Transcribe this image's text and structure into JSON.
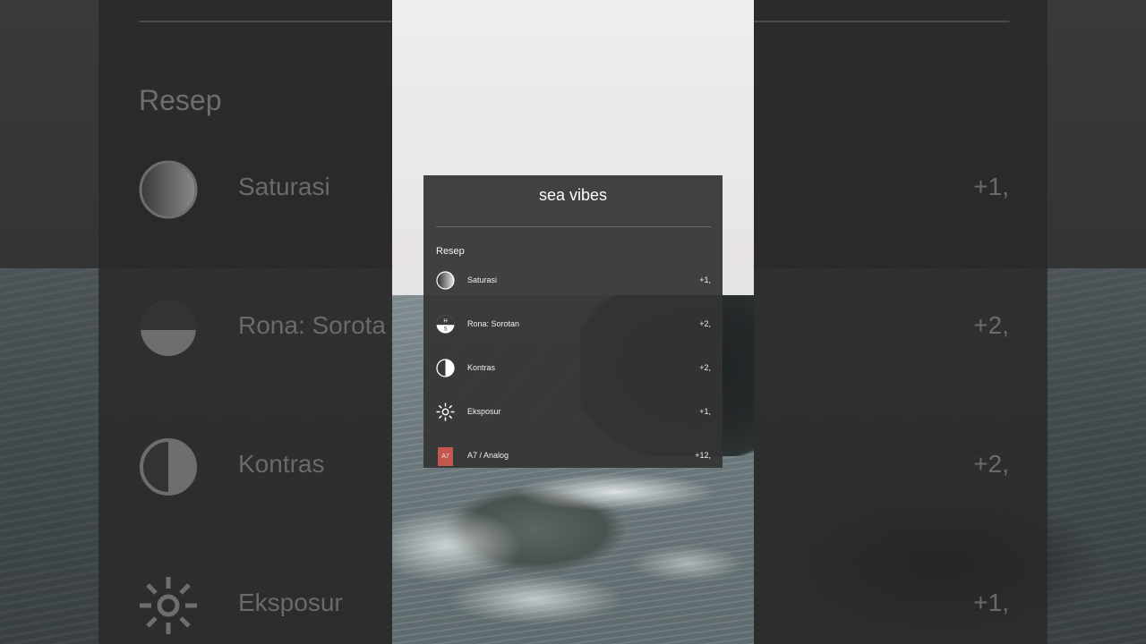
{
  "recipe": {
    "title": "sea vibes",
    "heading": "Resep",
    "items": [
      {
        "label": "Saturasi",
        "value": "+1,",
        "icon": "saturation-icon"
      },
      {
        "label": "Rona: Sorotan",
        "value": "+2,",
        "icon": "hue-shadow-icon"
      },
      {
        "label": "Kontras",
        "value": "+2,",
        "icon": "contrast-icon"
      },
      {
        "label": "Eksposur",
        "value": "+1,",
        "icon": "exposure-icon"
      },
      {
        "label": "A7 / Analog",
        "value": "+12,",
        "icon": "filter-badge-icon",
        "badge": "A7",
        "badge_color": "#c4574f"
      }
    ]
  },
  "background": {
    "heading": "Resep",
    "items": [
      {
        "label": "Saturasi",
        "value": "+1,"
      },
      {
        "label": "Rona: Sorota",
        "value": "+2,"
      },
      {
        "label": "Kontras",
        "value": "+2,"
      },
      {
        "label": "Eksposur",
        "value": "+1,"
      }
    ]
  },
  "icon_glyphs": {
    "hue_top": "H",
    "hue_bottom": "S"
  }
}
